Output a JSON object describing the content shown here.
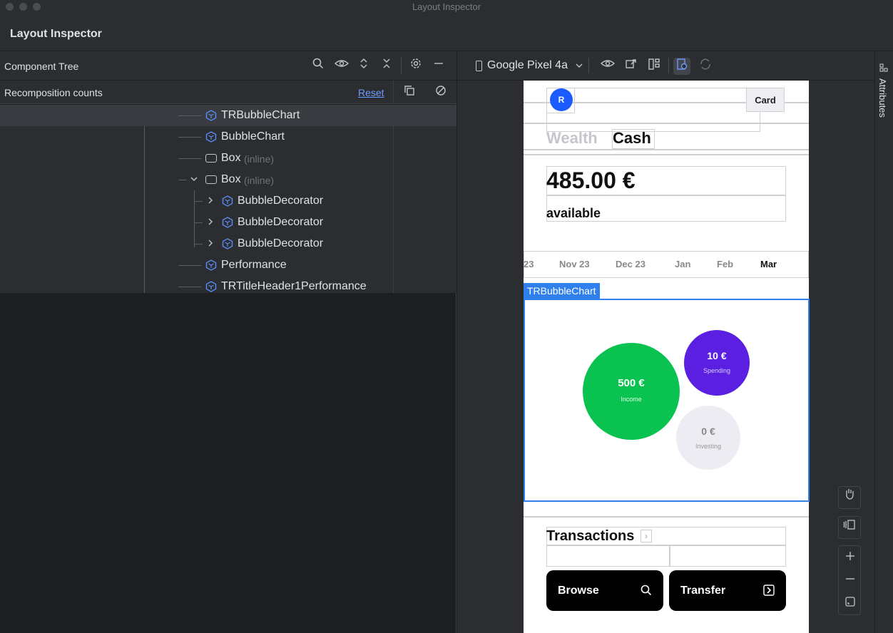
{
  "window": {
    "title": "Layout Inspector"
  },
  "app": {
    "title": "Layout Inspector"
  },
  "component_tree": {
    "title": "Component Tree",
    "recomposition_label": "Recomposition counts",
    "reset_label": "Reset",
    "rows": [
      {
        "label": "TRBubbleChart",
        "kind": "compose",
        "selected": true
      },
      {
        "label": "BubbleChart",
        "kind": "compose"
      },
      {
        "label": "Box",
        "tag": "(inline)",
        "kind": "box"
      },
      {
        "label": "Box",
        "tag": "(inline)",
        "kind": "box",
        "expanded": true
      },
      {
        "label": "BubbleDecorator",
        "kind": "compose"
      },
      {
        "label": "BubbleDecorator",
        "kind": "compose"
      },
      {
        "label": "BubbleDecorator",
        "kind": "compose"
      },
      {
        "label": "Performance",
        "kind": "compose"
      },
      {
        "label": "TRTitleHeader1Performance",
        "kind": "compose"
      }
    ]
  },
  "device": {
    "name": "Google Pixel 4a"
  },
  "phone": {
    "avatar": "R",
    "card_button": "Card",
    "tabs": [
      "Wealth",
      "Cash"
    ],
    "balance": "485.00 €",
    "available": "available",
    "months": [
      "23",
      "Nov 23",
      "Dec 23",
      "Jan",
      "Feb",
      "Mar"
    ],
    "bubbles": [
      {
        "amount": "500 €",
        "label": "Income",
        "color": "#0ac24f"
      },
      {
        "amount": "10 €",
        "label": "Spending",
        "color": "#5a1fe0"
      },
      {
        "amount": "0 €",
        "label": "Investing",
        "color": "#ececf2"
      }
    ],
    "transactions_title": "Transactions",
    "actions": [
      "Browse",
      "Transfer"
    ]
  },
  "selection_tag": "TRBubbleChart",
  "attributes_label": "Attributes",
  "colors": {
    "accent": "#2f80ed",
    "selected_row": "#393b40"
  }
}
